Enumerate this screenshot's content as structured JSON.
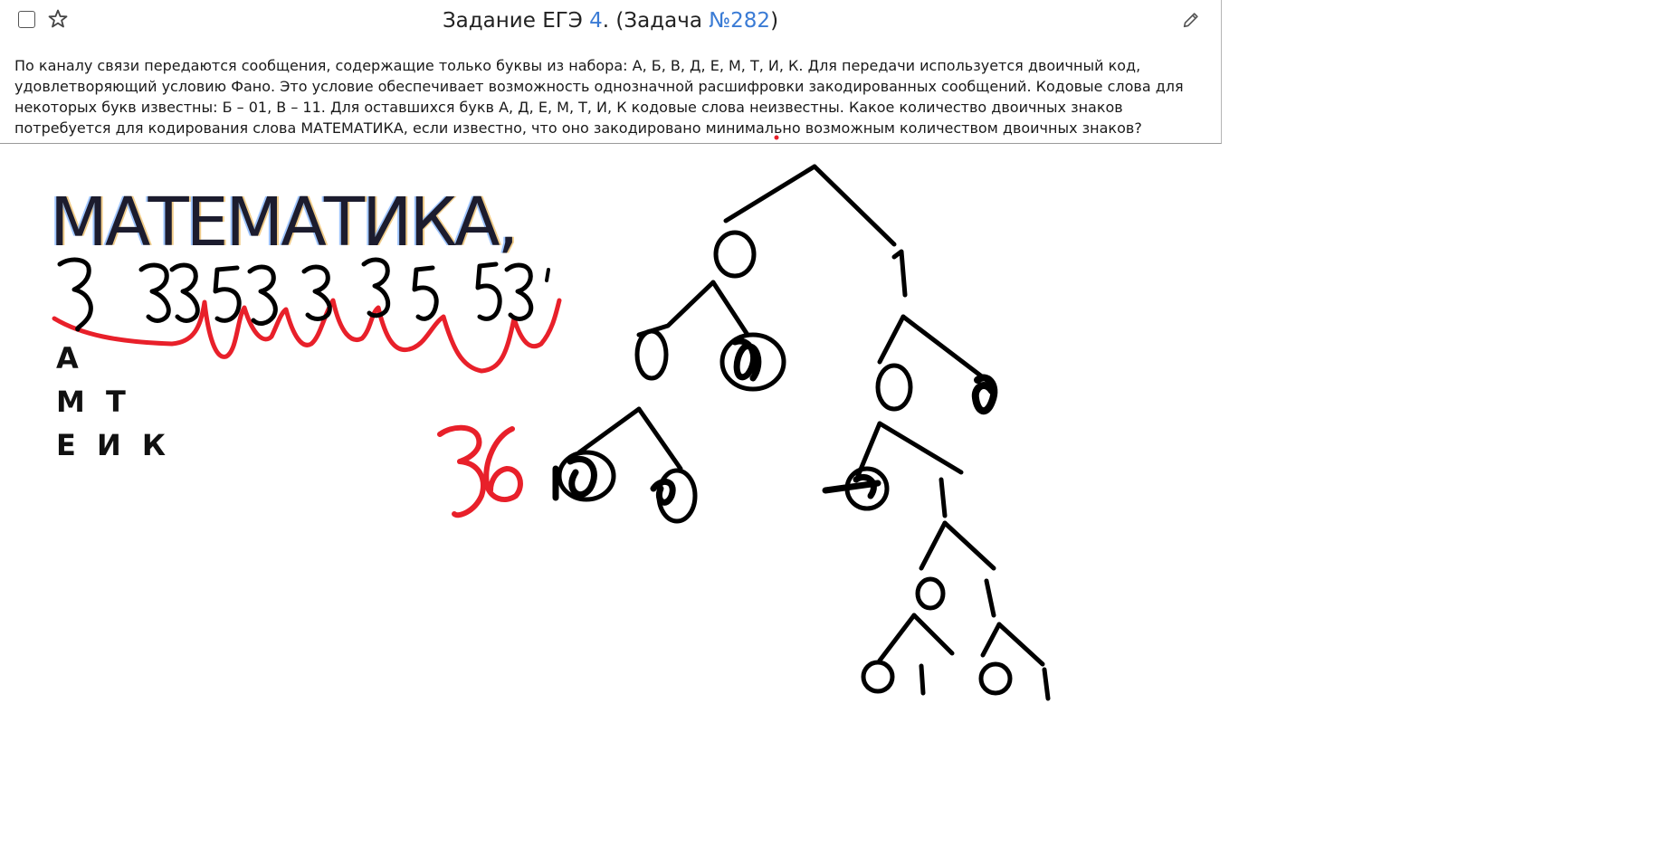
{
  "header": {
    "title_prefix": "Задание ЕГЭ ",
    "task_number": "4",
    "title_middle": ". (Задача ",
    "problem_id": "№282",
    "title_suffix": ")"
  },
  "task": {
    "text": "По каналу связи передаются сообщения, содержащие только буквы из набора: А, Б, В, Д, Е, М, Т, И, К. Для передачи используется двоичный код, удовлетворяющий условию Фано. Это условие обеспечивает возможность однозначной расшифровки закодированных сообщений. Кодовые слова для некоторых букв известны: Б – 01, В – 11. Для оставшихся букв А, Д, Е, М, Т, И, К кодовые слова неизвестны. Какое количество двоичных знаков потребуется для кодирования слова МАТЕМАТИКА, если известно, что оно закодировано минимально возможным количеством двоичных знаков?"
  },
  "canvas": {
    "word": "МАТЕМАТИКА,",
    "letter_groups": [
      "А",
      "М Т",
      "Е И К"
    ],
    "answer": "36",
    "digit_labels": [
      "3",
      "3",
      "3",
      "5",
      "3",
      "3",
      "3",
      "5",
      "5",
      "3"
    ],
    "tree_labels": [
      "0",
      "1",
      "0",
      "0",
      "1",
      "0",
      "1",
      "0",
      "1"
    ]
  },
  "colors": {
    "link": "#3a7bd5",
    "ink": "#000000",
    "red_ink": "#e8202a"
  }
}
